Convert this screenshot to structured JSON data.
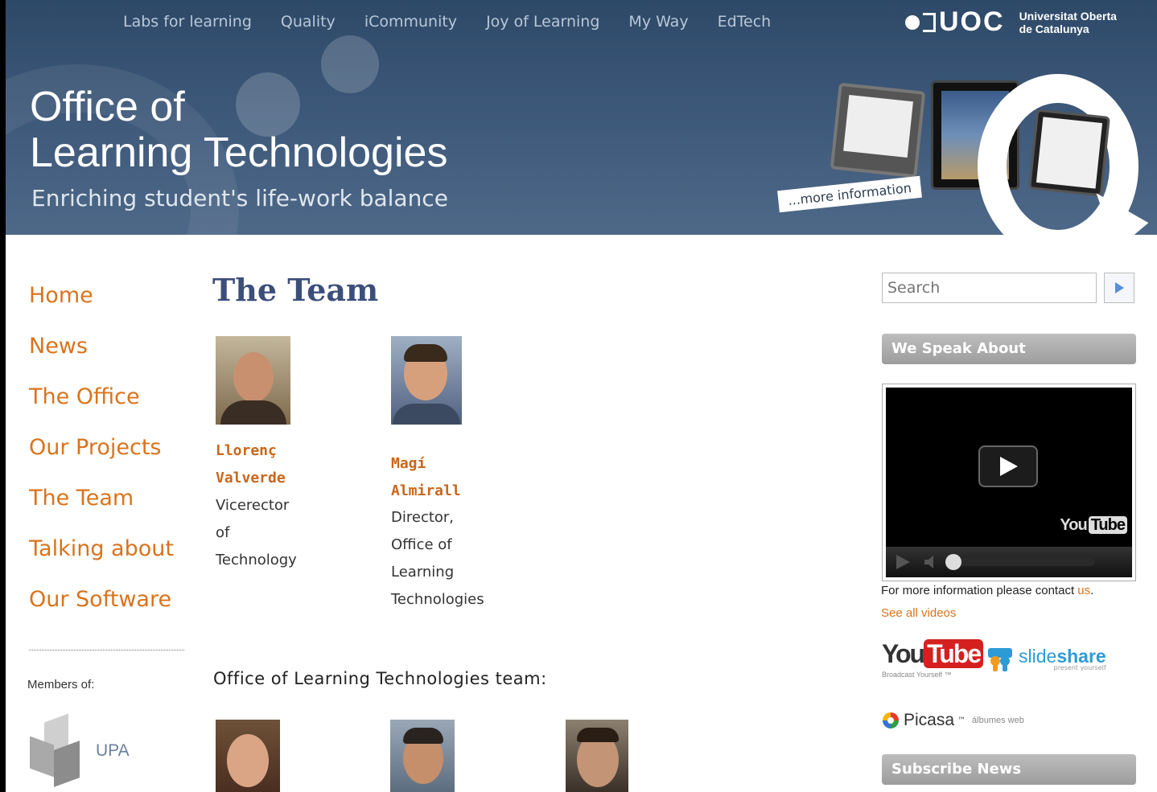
{
  "top_nav": [
    "Labs for learning",
    "Quality",
    "iCommunity",
    "Joy of Learning",
    "My Way",
    "EdTech"
  ],
  "header": {
    "title_line1": "Office of",
    "title_line2": "Learning Technologies",
    "tagline": "Enriching student's life-work balance",
    "more_info": "...more information"
  },
  "uoc_logo": {
    "mark": "UOC",
    "name_line1": "Universitat Oberta",
    "name_line2": "de Catalunya"
  },
  "left_nav": [
    "Home",
    "News",
    "The Office",
    "Our Projects",
    "The Team",
    "Talking about",
    "Our Software"
  ],
  "members": {
    "label": "Members of:",
    "upa": "UPA"
  },
  "main": {
    "title": "The Team",
    "leaders": [
      {
        "name_line1": "Llorenç",
        "name_line2": "Valverde",
        "role_lines": [
          "Vicerector",
          "of",
          "Technology"
        ]
      },
      {
        "name_line1": "Magí",
        "name_line2": "Almirall",
        "role_lines": [
          "Director,",
          "Office of",
          "Learning",
          "Technologies"
        ]
      }
    ],
    "team_heading": "Office of Learning Technologies team:"
  },
  "sidebar": {
    "search_placeholder": "Search",
    "we_speak_about": "We Speak About",
    "video_brand": "You",
    "video_brand_tube": "Tube",
    "contact_text": "For more information please contact ",
    "contact_link": "us",
    "contact_end": ".",
    "see_all": "See all videos",
    "youtube_you": "You",
    "youtube_tube": "Tube",
    "youtube_sub": "Broadcast Yourself ™",
    "slideshare_a": "slide",
    "slideshare_b": "share",
    "slideshare_sub": "present yourself",
    "picasa": "Picasa",
    "picasa_tm": "™",
    "picasa_sub": "álbumes web",
    "subscribe": "Subscribe News"
  },
  "colors": {
    "header_blue": "#3f5a7b",
    "accent_orange": "#d9731d",
    "title_blue": "#3c4e7a"
  }
}
